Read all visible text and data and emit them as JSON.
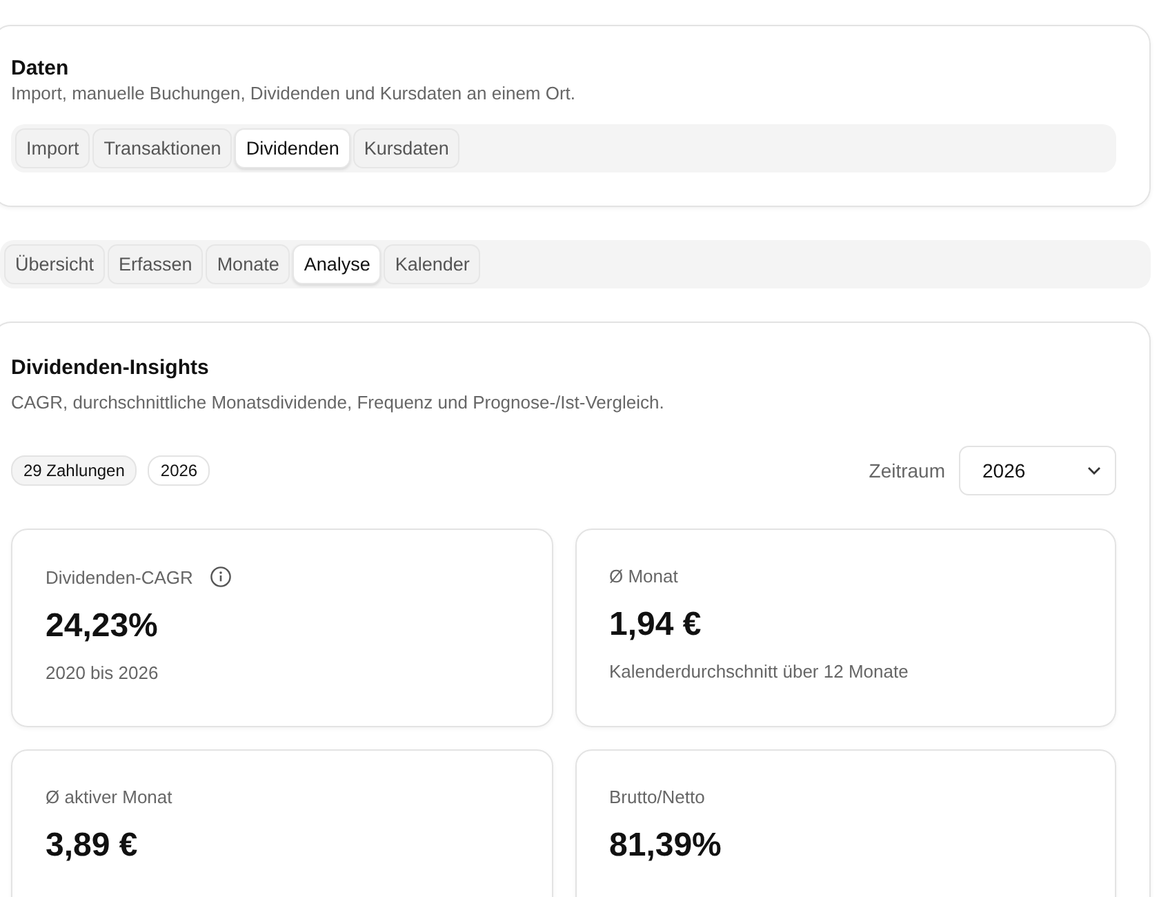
{
  "data_card": {
    "title": "Daten",
    "description": "Import, manuelle Buchungen, Dividenden und Kursdaten an einem Ort.",
    "tabs": [
      {
        "label": "Import",
        "selected": false
      },
      {
        "label": "Transaktionen",
        "selected": false
      },
      {
        "label": "Dividenden",
        "selected": true
      },
      {
        "label": "Kursdaten",
        "selected": false
      }
    ]
  },
  "sub_tabs": [
    {
      "label": "Übersicht",
      "selected": false
    },
    {
      "label": "Erfassen",
      "selected": false
    },
    {
      "label": "Monate",
      "selected": false
    },
    {
      "label": "Analyse",
      "selected": true
    },
    {
      "label": "Kalender",
      "selected": false
    }
  ],
  "insights": {
    "title": "Dividenden-Insights",
    "description": "CAGR, durchschnittliche Monatsdividende, Frequenz und Prognose-/Ist-Vergleich.",
    "badges": [
      "29 Zahlungen",
      "2026"
    ],
    "period": {
      "label": "Zeitraum",
      "value": "2026"
    },
    "stats": [
      {
        "label": "Dividenden-CAGR",
        "info": true,
        "value": "24,23%",
        "sub": "2020 bis 2026"
      },
      {
        "label": "Ø Monat",
        "info": false,
        "value": "1,94 €",
        "sub": "Kalenderdurchschnitt über 12 Monate"
      },
      {
        "label": "Ø aktiver Monat",
        "info": false,
        "value": "3,89 €"
      },
      {
        "label": "Brutto/Netto",
        "info": false,
        "value": "81,39%"
      }
    ]
  }
}
